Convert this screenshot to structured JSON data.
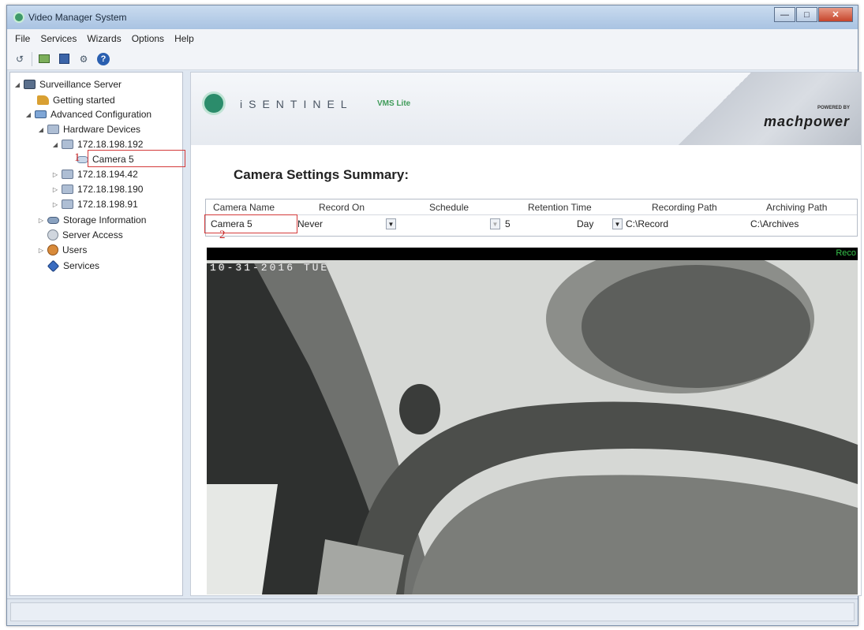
{
  "window": {
    "title": "Video Manager System"
  },
  "menubar": {
    "items": [
      "File",
      "Services",
      "Wizards",
      "Options",
      "Help"
    ]
  },
  "toolbar": {
    "icons": [
      "refresh-icon",
      "folder-icon",
      "save-icon",
      "settings-icon",
      "help-icon"
    ],
    "help_glyph": "?"
  },
  "tree": {
    "root": "Surveillance Server",
    "getting_started": "Getting started",
    "advanced_config": "Advanced Configuration",
    "hardware_devices": "Hardware Devices",
    "devices": [
      "172.18.198.192",
      "172.18.194.42",
      "172.18.198.190",
      "172.18.198.91"
    ],
    "selected_camera": "Camera 5",
    "storage": "Storage Information",
    "server_access": "Server Access",
    "users": "Users",
    "services": "Services"
  },
  "annotations": {
    "step1": "1",
    "step2": "2"
  },
  "banner": {
    "brand": "iSENTINEL",
    "edition": "VMS Lite",
    "powered_by": "POWERED BY",
    "partner": "machpower"
  },
  "page": {
    "title": "Camera Settings Summary:"
  },
  "table": {
    "headers": [
      "Camera Name",
      "Record On",
      "Schedule",
      "Retention Time",
      "Recording Path",
      "Archiving Path"
    ],
    "row": {
      "camera_name": "Camera 5",
      "record_on": "Never",
      "schedule": "",
      "retention_value": "5",
      "retention_unit": "Day",
      "recording_path": "C:\\Record",
      "archiving_path": "C:\\Archives"
    }
  },
  "video": {
    "osd_datetime": "10-31-2016 TUE",
    "rec_label": "Reco"
  },
  "colors": {
    "annotation": "#d43a3a",
    "brand_green": "#2b8c6b"
  }
}
